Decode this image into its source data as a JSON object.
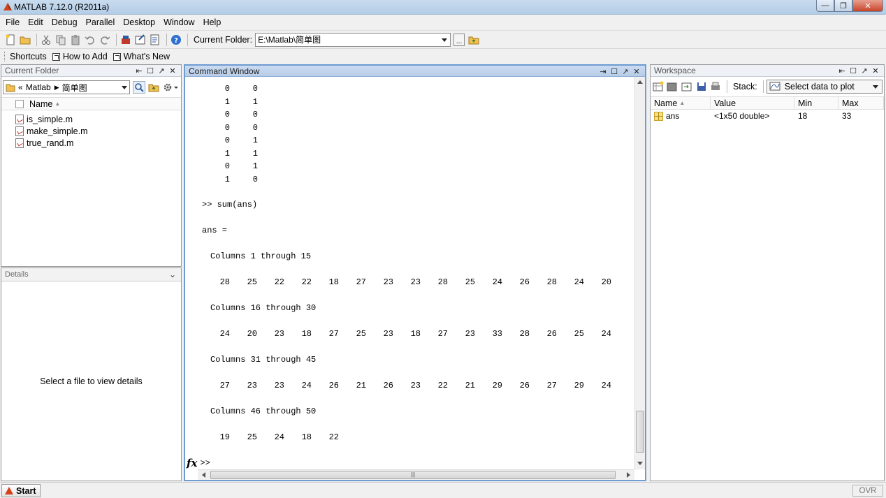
{
  "window": {
    "title": "MATLAB  7.12.0 (R2011a)"
  },
  "menu": [
    "File",
    "Edit",
    "Debug",
    "Parallel",
    "Desktop",
    "Window",
    "Help"
  ],
  "toolbar": {
    "current_folder_label": "Current Folder:",
    "current_folder_value": "E:\\Matlab\\简单图",
    "browse_label": "..."
  },
  "shortcuts": {
    "label": "Shortcuts",
    "how_to_add": "How to Add",
    "whats_new": "What's New"
  },
  "current_folder": {
    "title": "Current Folder",
    "path_prefix": "«",
    "path": "Matlab",
    "path_sub": "简单图",
    "column_name": "Name",
    "files": [
      "is_simple.m",
      "make_simple.m",
      "true_rand.m"
    ]
  },
  "details": {
    "title": "Details",
    "message": "Select a file to view details"
  },
  "command_window": {
    "title": "Command Window",
    "pair_rows": [
      [
        "0",
        "0"
      ],
      [
        "1",
        "1"
      ],
      [
        "0",
        "0"
      ],
      [
        "0",
        "0"
      ],
      [
        "0",
        "1"
      ],
      [
        "1",
        "1"
      ],
      [
        "0",
        "1"
      ],
      [
        "1",
        "0"
      ]
    ],
    "command": ">> sum(ans)",
    "ans_label": "ans =",
    "blocks": [
      {
        "header": "Columns 1 through 15",
        "values": [
          "28",
          "25",
          "22",
          "22",
          "18",
          "27",
          "23",
          "23",
          "28",
          "25",
          "24",
          "26",
          "28",
          "24",
          "20"
        ]
      },
      {
        "header": "Columns 16 through 30",
        "values": [
          "24",
          "20",
          "23",
          "18",
          "27",
          "25",
          "23",
          "18",
          "27",
          "23",
          "33",
          "28",
          "26",
          "25",
          "24"
        ]
      },
      {
        "header": "Columns 31 through 45",
        "values": [
          "27",
          "23",
          "23",
          "24",
          "26",
          "21",
          "26",
          "23",
          "22",
          "21",
          "29",
          "26",
          "27",
          "29",
          "24"
        ]
      },
      {
        "header": "Columns 46 through 50",
        "values": [
          "19",
          "25",
          "24",
          "18",
          "22"
        ]
      }
    ],
    "prompt": ">>",
    "fx": "fx"
  },
  "workspace": {
    "title": "Workspace",
    "stack_label": "Stack:",
    "plot_select": "Select data to plot",
    "columns": [
      "Name",
      "Value",
      "Min",
      "Max"
    ],
    "rows": [
      {
        "name": "ans",
        "value": "<1x50 double>",
        "min": "18",
        "max": "33"
      }
    ]
  },
  "status": {
    "start": "Start",
    "ovr": "OVR"
  },
  "colors": {
    "command_border": "#6e9bd1",
    "start_icon": "#d2421b"
  }
}
